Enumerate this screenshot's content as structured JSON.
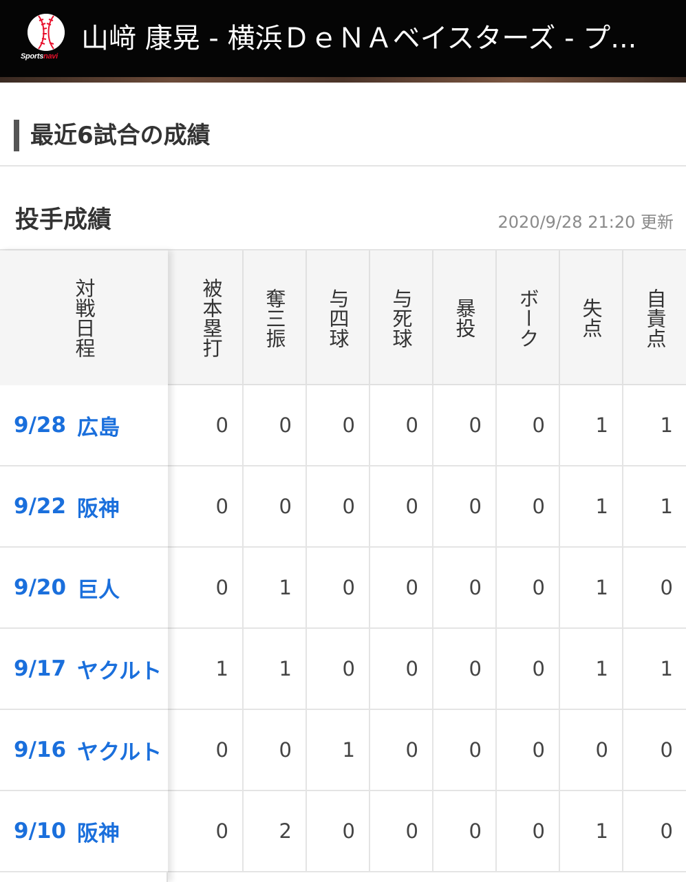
{
  "header": {
    "logo_text_main": "Sports",
    "logo_text_accent": "navi",
    "page_title": "山﨑 康晃 - 横浜ＤｅＮＡベイスターズ - プ..."
  },
  "section": {
    "title": "最近6試合の成績"
  },
  "pitching": {
    "title": "投手成績",
    "updated": "2020/9/28  21:20 更新",
    "fixed_header": "対戦日程",
    "columns": [
      "被本塁打",
      "奪三振",
      "与四球",
      "与死球",
      "暴投",
      "ボーク",
      "失点",
      "自責点"
    ],
    "rows": [
      {
        "date": "9/28",
        "opponent": "広島",
        "values": [
          "0",
          "0",
          "0",
          "0",
          "0",
          "0",
          "1",
          "1"
        ]
      },
      {
        "date": "9/22",
        "opponent": "阪神",
        "values": [
          "0",
          "0",
          "0",
          "0",
          "0",
          "0",
          "1",
          "1"
        ]
      },
      {
        "date": "9/20",
        "opponent": "巨人",
        "values": [
          "0",
          "1",
          "0",
          "0",
          "0",
          "0",
          "1",
          "0"
        ]
      },
      {
        "date": "9/17",
        "opponent": "ヤクルト",
        "values": [
          "1",
          "1",
          "0",
          "0",
          "0",
          "0",
          "1",
          "1"
        ]
      },
      {
        "date": "9/16",
        "opponent": "ヤクルト",
        "values": [
          "0",
          "0",
          "1",
          "0",
          "0",
          "0",
          "0",
          "0"
        ]
      },
      {
        "date": "9/10",
        "opponent": "阪神",
        "values": [
          "0",
          "2",
          "0",
          "0",
          "0",
          "0",
          "1",
          "0"
        ]
      }
    ]
  },
  "colors": {
    "header_bg": "#050505",
    "link": "#1a6fdc",
    "accent_red": "#e8112d"
  }
}
